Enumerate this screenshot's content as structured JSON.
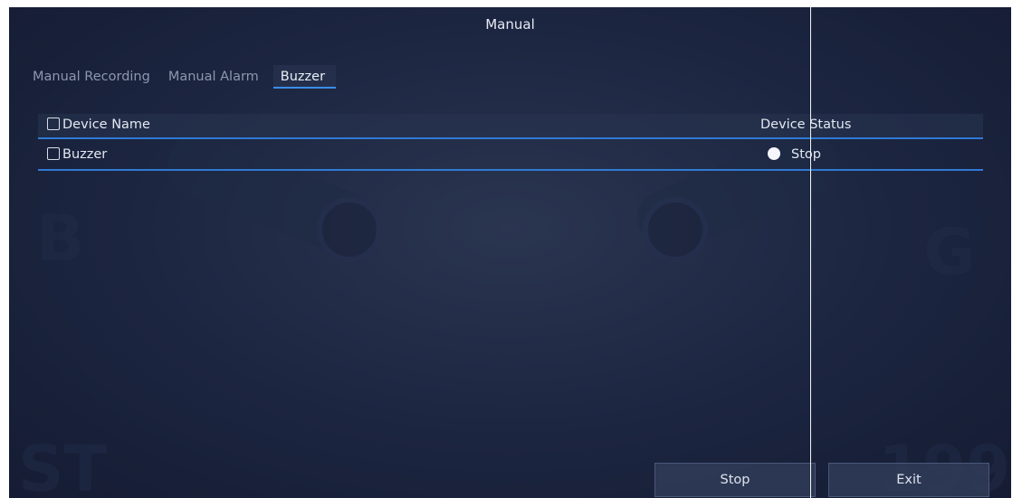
{
  "window": {
    "title": "Manual"
  },
  "tabs": [
    {
      "label": "Manual Recording",
      "active": false
    },
    {
      "label": "Manual Alarm",
      "active": false
    },
    {
      "label": "Buzzer",
      "active": true
    }
  ],
  "table": {
    "headers": {
      "name": "Device Name",
      "status": "Device Status"
    },
    "rows": [
      {
        "name": "Buzzer",
        "status": "Stop"
      }
    ]
  },
  "buttons": {
    "stop": "Stop",
    "exit": "Exit"
  },
  "colors": {
    "accent": "#2f7ad6",
    "background": "#1c2540"
  }
}
